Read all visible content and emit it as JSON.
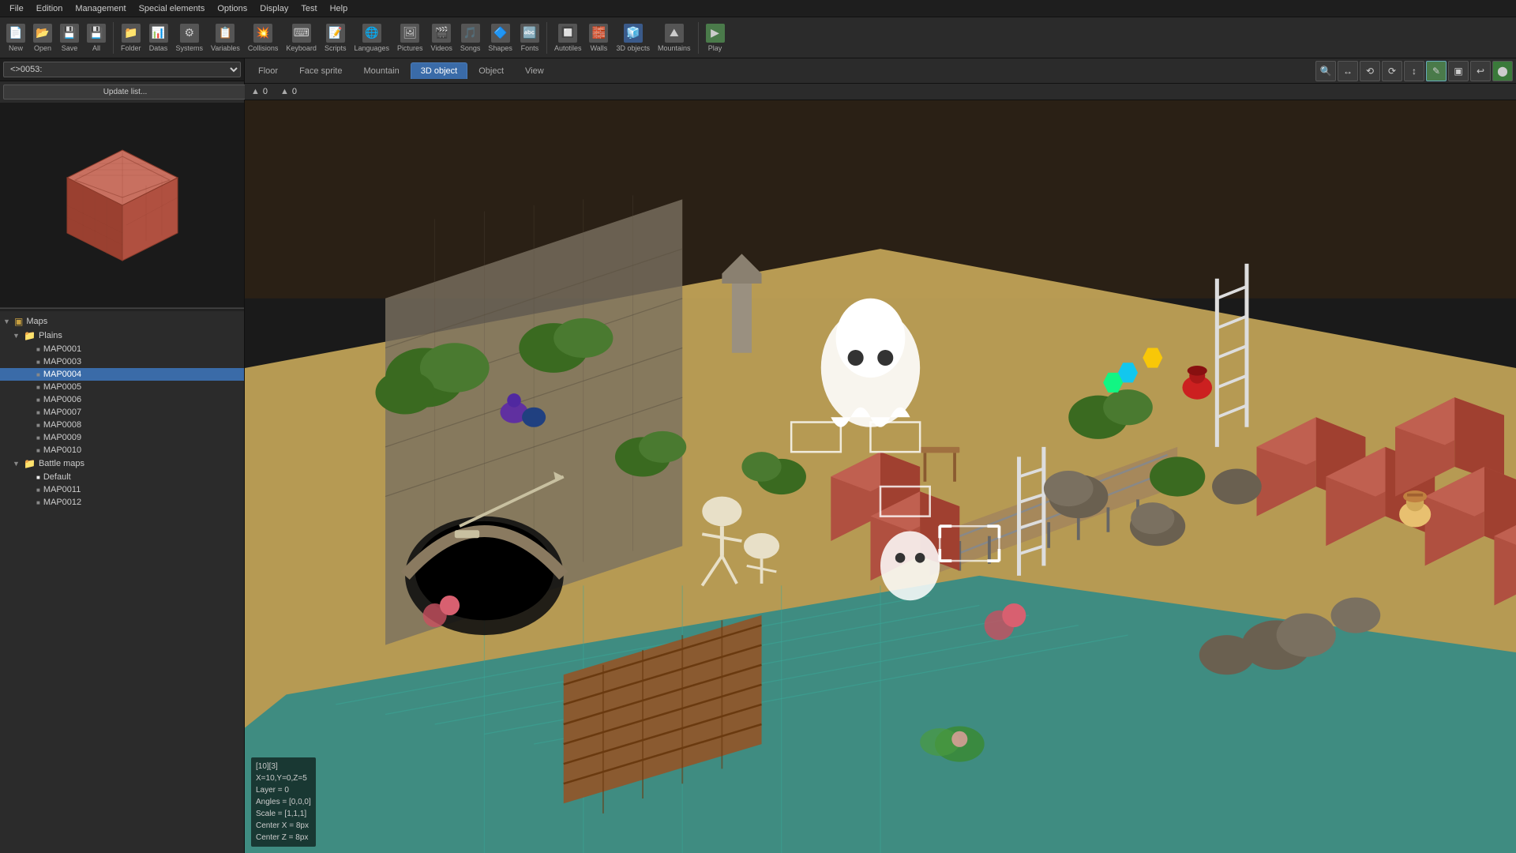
{
  "app": {
    "title": "RPG Paper Maker"
  },
  "menubar": {
    "items": [
      "File",
      "Edition",
      "Management",
      "Special elements",
      "Options",
      "Display",
      "Test",
      "Help"
    ]
  },
  "toolbar": {
    "buttons": [
      {
        "label": "New",
        "icon": "📄"
      },
      {
        "label": "Open",
        "icon": "📂"
      },
      {
        "label": "Save",
        "icon": "💾"
      },
      {
        "label": "All",
        "icon": "💾"
      },
      {
        "label": "Folder",
        "icon": "📁"
      },
      {
        "label": "Datas",
        "icon": "📊"
      },
      {
        "label": "Systems",
        "icon": "⚙"
      },
      {
        "label": "Variables",
        "icon": "📋"
      },
      {
        "label": "Collisions",
        "icon": "💥"
      },
      {
        "label": "Keyboard",
        "icon": "⌨"
      },
      {
        "label": "Scripts",
        "icon": "📝"
      },
      {
        "label": "Languages",
        "icon": "🌐"
      },
      {
        "label": "Pictures",
        "icon": "🖼"
      },
      {
        "label": "Videos",
        "icon": "🎬"
      },
      {
        "label": "Songs",
        "icon": "🎵"
      },
      {
        "label": "Shapes",
        "icon": "🔷"
      },
      {
        "label": "Fonts",
        "icon": "🔤"
      },
      {
        "label": "Autotiles",
        "icon": "🔲"
      },
      {
        "label": "Walls",
        "icon": "🧱"
      },
      {
        "label": "3D objects",
        "icon": "🧊"
      },
      {
        "label": "Mountains",
        "icon": "⛰"
      },
      {
        "label": "Play",
        "icon": "▶"
      }
    ]
  },
  "left_panel": {
    "dropdown_value": "<>0053:",
    "update_btn": "Update list...",
    "tree": {
      "items": [
        {
          "label": "Maps",
          "indent": 0,
          "type": "expand",
          "expanded": true
        },
        {
          "label": "Plains",
          "indent": 1,
          "type": "folder",
          "expanded": true
        },
        {
          "label": "MAP0001",
          "indent": 2,
          "type": "map"
        },
        {
          "label": "MAP0003",
          "indent": 2,
          "type": "map"
        },
        {
          "label": "MAP0004",
          "indent": 2,
          "type": "map",
          "selected": true
        },
        {
          "label": "MAP0005",
          "indent": 2,
          "type": "map"
        },
        {
          "label": "MAP0006",
          "indent": 2,
          "type": "map"
        },
        {
          "label": "MAP0007",
          "indent": 2,
          "type": "map"
        },
        {
          "label": "MAP0008",
          "indent": 2,
          "type": "map"
        },
        {
          "label": "MAP0009",
          "indent": 2,
          "type": "map"
        },
        {
          "label": "MAP0010",
          "indent": 2,
          "type": "map"
        },
        {
          "label": "Battle maps",
          "indent": 1,
          "type": "folder",
          "expanded": true
        },
        {
          "label": "Default",
          "indent": 2,
          "type": "map-white"
        },
        {
          "label": "MAP0011",
          "indent": 2,
          "type": "map"
        },
        {
          "label": "MAP0012",
          "indent": 2,
          "type": "map"
        }
      ]
    }
  },
  "viewport": {
    "tabs": [
      "Floor",
      "Face sprite",
      "Mountain",
      "3D object",
      "Object",
      "View"
    ],
    "active_tab": "3D object",
    "coord_x": "0",
    "coord_y": "0",
    "tools": [
      "🔍",
      "↔",
      "⟲",
      "⟳",
      "↕",
      "✎",
      "▣",
      "↩",
      "🟢"
    ],
    "info": {
      "pos": "[10][3]",
      "coords": "X=10,Y=0,Z=5",
      "layer": "Layer = 0",
      "angles": "Angles = [0,0,0]",
      "scale": "Scale = [1,1,1]",
      "center_x": "Center X = 8px",
      "center_z": "Center Z = 8px"
    }
  }
}
